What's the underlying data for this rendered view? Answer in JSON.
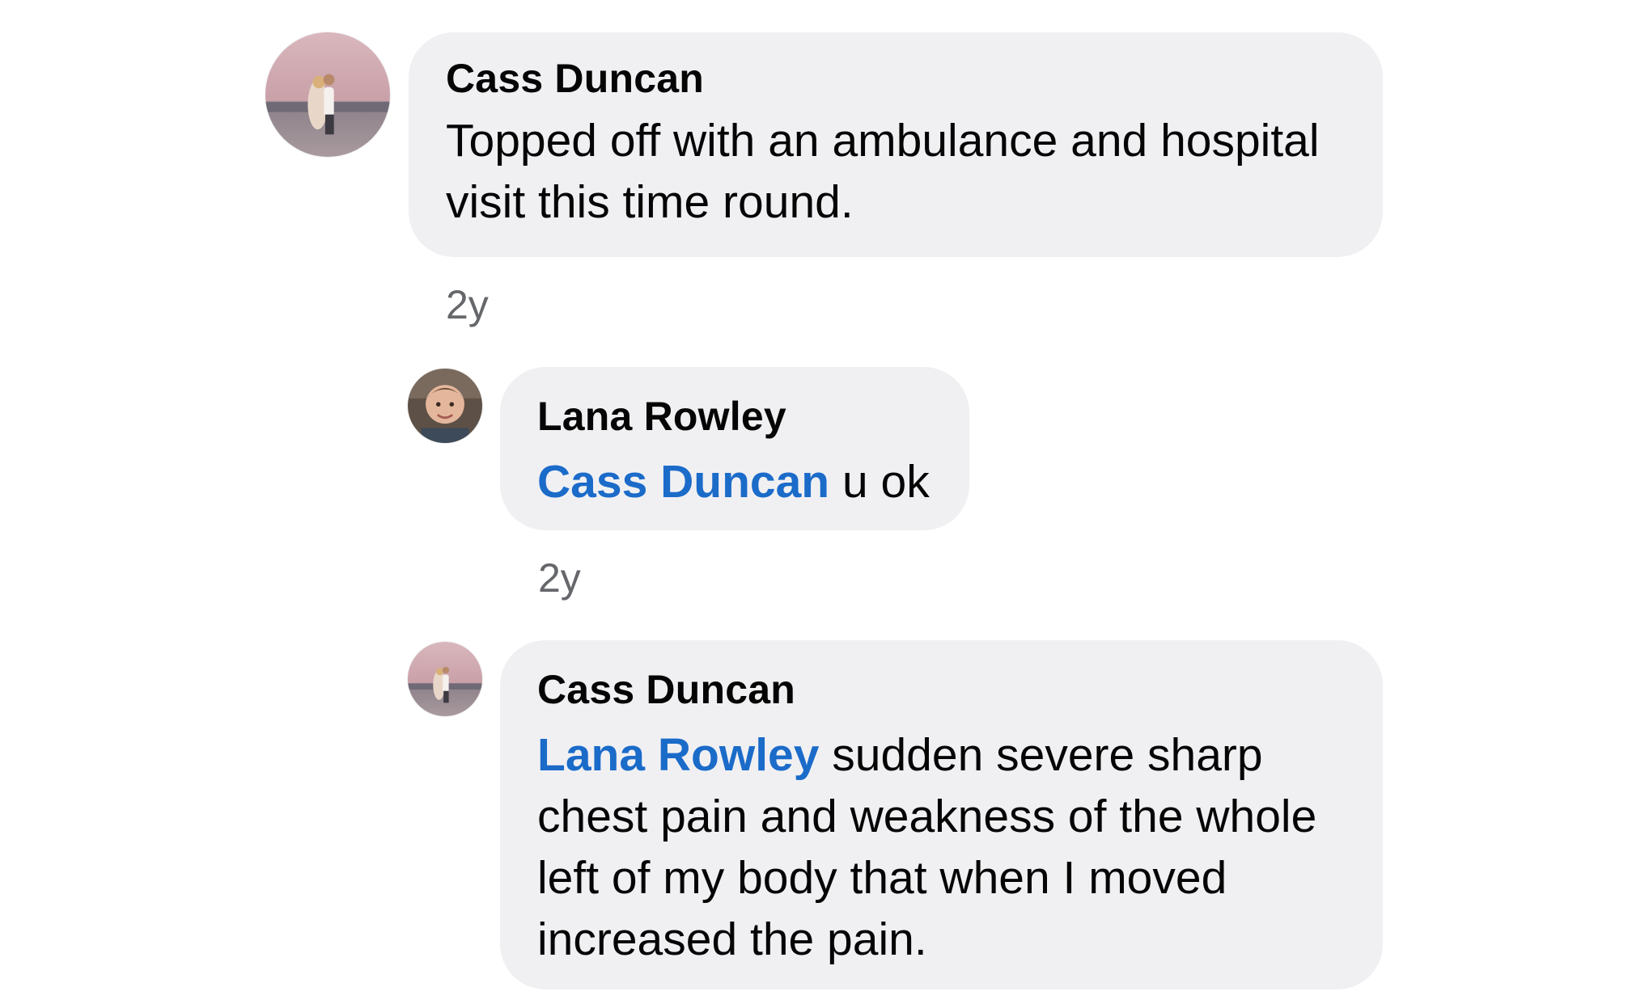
{
  "comments": [
    {
      "author": "Cass Duncan",
      "text": "Topped off with an ambulance and hospital visit this time round.",
      "time": "2y",
      "avatar_icon": "profile-photo-couple-beach"
    },
    {
      "author": "Lana Rowley",
      "mention": "Cass Duncan",
      "text": " u ok",
      "time": "2y",
      "avatar_icon": "profile-photo-child"
    },
    {
      "author": "Cass Duncan",
      "mention": "Lana Rowley",
      "text": " sudden severe sharp chest pain and weakness of the whole left of my body that when I moved increased the pain.",
      "avatar_icon": "profile-photo-couple-beach"
    }
  ],
  "colors": {
    "bubble": "#f0f0f3",
    "mention": "#1b6bc9",
    "timestamp": "#65676b"
  }
}
